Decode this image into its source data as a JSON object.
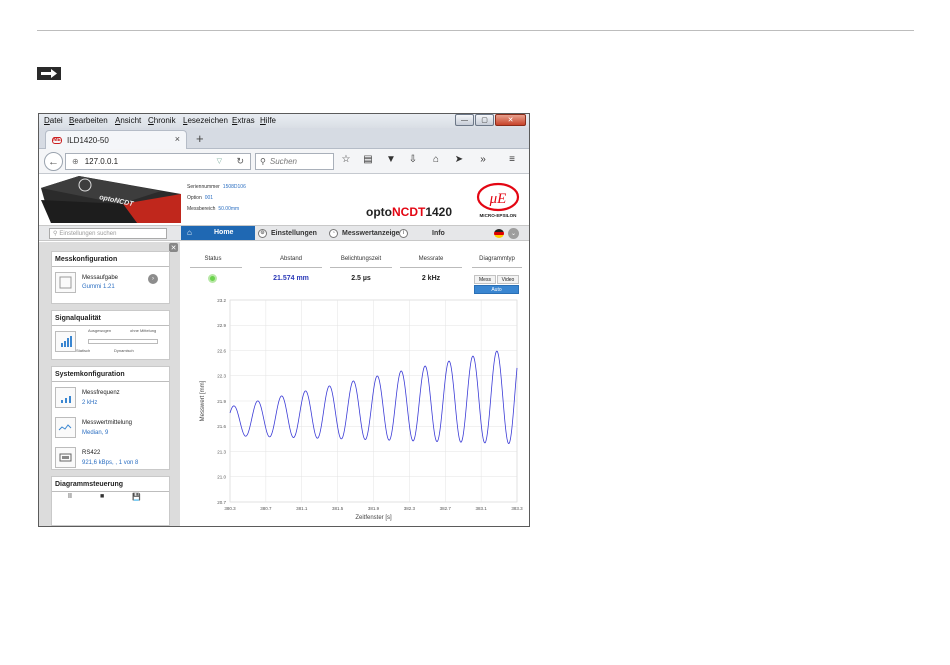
{
  "browser": {
    "menu": [
      "Datei",
      "Bearbeiten",
      "Ansicht",
      "Chronik",
      "Lesezeichen",
      "Extras",
      "Hilfe"
    ],
    "tab_title": "ILD1420-50",
    "tab_favicon_text": "ME",
    "tab_close": "×",
    "new_tab": "+",
    "url": "127.0.0.1",
    "search_placeholder": "Suchen"
  },
  "header": {
    "sensor_label": "optoNCDT",
    "serial_label": "Seriennummer",
    "serial_value": "1508D106",
    "option_label": "Option",
    "option_value": "001",
    "range_label": "Messbereich",
    "range_value": "50.00mm",
    "brand_prefix": "opto",
    "brand_red": "NCDT",
    "brand_suffix": "1420",
    "logo_text": "MICRO-EPSILON"
  },
  "app_nav": {
    "settings_search_placeholder": "Einstellungen suchen",
    "home": "Home",
    "settings": "Einstellungen",
    "measurement": "Messwertanzeige",
    "info": "Info"
  },
  "sidebar": {
    "meas_config": {
      "title": "Messkonfiguration",
      "label": "Messaufgabe",
      "value": "Gummi 1.21"
    },
    "signal_quality": {
      "title": "Signalqualität",
      "left_top": "Ausgewogen",
      "right_top": "ohne Mittelung",
      "left_bottom": "Statisch",
      "right_bottom": "Dynamisch"
    },
    "system_config": {
      "title": "Systemkonfiguration",
      "items": [
        {
          "label": "Messfrequenz",
          "value": "2 kHz"
        },
        {
          "label": "Messwertmittelung",
          "value": "Median, 9"
        },
        {
          "label": "RS422",
          "value": "921,6 kBps, , 1 von 8"
        }
      ]
    },
    "chart_control": {
      "title": "Diagrammsteuerung",
      "pause": "II",
      "stop": "■",
      "save": "💾"
    }
  },
  "stats": {
    "status_label": "Status",
    "distance_label": "Abstand",
    "distance_value": "21.574 mm",
    "exposure_label": "Belichtungszeit",
    "exposure_value": "2.5 µs",
    "rate_label": "Messrate",
    "rate_value": "2 kHz",
    "chart_type_label": "Diagrammtyp",
    "btn_meas": "Mess",
    "btn_video": "Video",
    "btn_auto": "Auto"
  },
  "chart_data": {
    "type": "line",
    "title": "",
    "xlabel": "Zeitfenster [s]",
    "ylabel": "Messwert [mm]",
    "xlim": [
      380.3,
      383.3
    ],
    "ylim": [
      20.7,
      23.2
    ],
    "xticks": [
      "380.3",
      "380.7",
      "381.1",
      "381.5",
      "381.9",
      "382.3",
      "382.7",
      "383.1",
      "383.3"
    ],
    "yticks": [
      "20.7",
      "21.0",
      "21.3",
      "21.6",
      "21.9",
      "22.3",
      "22.6",
      "22.9",
      "23.2"
    ],
    "series": [
      {
        "color": "#3b3bd6",
        "cycles": 12,
        "offset_start": 21.7,
        "offset_end": 22.02,
        "amplitude_start": 0.18,
        "amplitude_end": 0.6
      }
    ],
    "grid": true,
    "accent": "#3b3bd6"
  },
  "colors": {
    "accent_blue": "#1f68b3",
    "brand_red": "#e30613",
    "status_green": "#6bd34d"
  }
}
